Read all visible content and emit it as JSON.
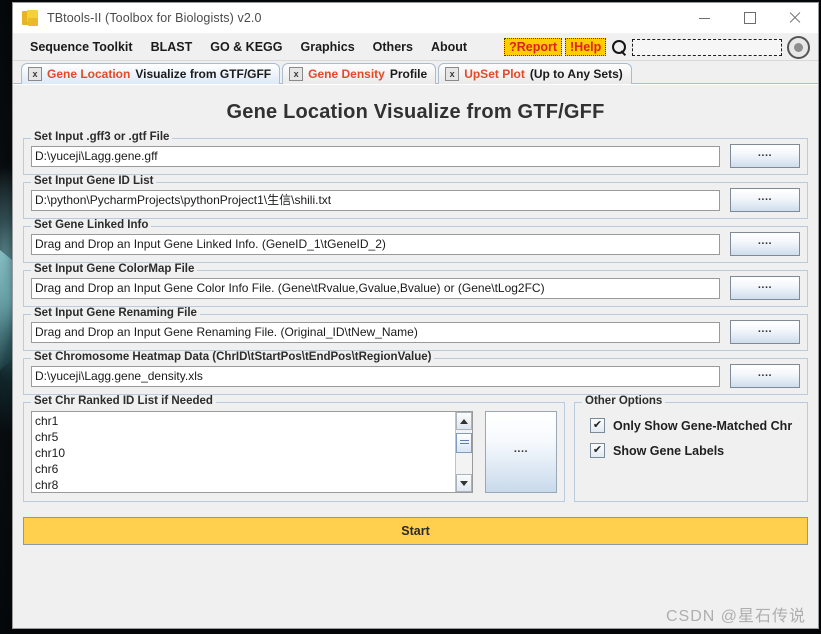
{
  "window": {
    "title": "TBtools-II (Toolbox for Biologists) v2.0",
    "app_icon": "tbtools-logo-icon",
    "controls": {
      "minimize": "minimize-icon",
      "maximize": "maximize-icon",
      "close": "close-icon"
    }
  },
  "menubar": {
    "items": [
      {
        "label": "Sequence Toolkit"
      },
      {
        "label": "BLAST"
      },
      {
        "label": "GO & KEGG"
      },
      {
        "label": "Graphics"
      },
      {
        "label": "Others"
      },
      {
        "label": "About"
      }
    ],
    "report_label": "?Report",
    "help_label": "!Help",
    "search_icon": "search-icon",
    "search_value": "",
    "search_placeholder": "",
    "record_icon": "record-target-icon",
    "highlight_bg": "#ffcc00",
    "highlight_fg": "#e02020"
  },
  "tabs": [
    {
      "close_icon": "x",
      "accent": "Gene Location",
      "rest": "Visualize from GTF/GFF",
      "active": true
    },
    {
      "close_icon": "x",
      "accent": "Gene Density",
      "rest": "Profile",
      "active": false
    },
    {
      "close_icon": "x",
      "accent": "UpSet Plot",
      "rest": "(Up to Any Sets)",
      "active": false
    }
  ],
  "main": {
    "page_title": "Gene Location Visualize from GTF/GFF",
    "browse_label": "....",
    "groups": [
      {
        "label": "Set Input .gff3 or .gtf File",
        "value": "D:\\yuceji\\Lagg.gene.gff",
        "placeholder": "",
        "button": "...."
      },
      {
        "label": "Set Input Gene ID List",
        "value": "D:\\python\\PycharmProjects\\pythonProject1\\生信\\shili.txt",
        "placeholder": "",
        "button": "...."
      },
      {
        "label": "Set Gene Linked Info",
        "value": "Drag and Drop an Input Gene Linked Info. (GeneID_1\\tGeneID_2)",
        "placeholder": "Drag and Drop an Input Gene Linked Info. (GeneID_1\\tGeneID_2)",
        "button": "...."
      },
      {
        "label": "Set Input Gene ColorMap File",
        "value": "Drag and Drop an Input Gene Color Info File. (Gene\\tRvalue,Gvalue,Bvalue) or (Gene\\tLog2FC)",
        "placeholder": "Drag and Drop an Input Gene Color Info File. (Gene\\tRvalue,Gvalue,Bvalue) or (Gene\\tLog2FC)",
        "button": "...."
      },
      {
        "label": "Set Input Gene Renaming File",
        "value": "Drag and Drop an Input Gene Renaming File. (Original_ID\\tNew_Name)",
        "placeholder": "Drag and Drop an Input Gene Renaming File. (Original_ID\\tNew_Name)",
        "button": "...."
      },
      {
        "label": "Set Chromosome Heatmap Data (ChrID\\tStartPos\\tEndPos\\tRegionValue)",
        "value": "D:\\yuceji\\Lagg.gene_density.xls",
        "placeholder": "",
        "button": "...."
      }
    ],
    "chr_group": {
      "label": "Set Chr Ranked ID List if Needed",
      "items": [
        "chr1",
        "chr5",
        "chr10",
        "chr6",
        "chr8"
      ],
      "button": "....",
      "scroll_up_icon": "scroll-up-arrow-icon",
      "scroll_down_icon": "scroll-down-arrow-icon"
    },
    "options_group": {
      "label": "Other Options",
      "items": [
        {
          "label": "Only Show Gene-Matched Chr",
          "checked": true,
          "mark": "✔"
        },
        {
          "label": "Show Gene Labels",
          "checked": true,
          "mark": "✔"
        }
      ]
    },
    "start_button": {
      "label": "Start",
      "color": "#ffcf4d"
    }
  },
  "watermark": "CSDN @星石传说"
}
